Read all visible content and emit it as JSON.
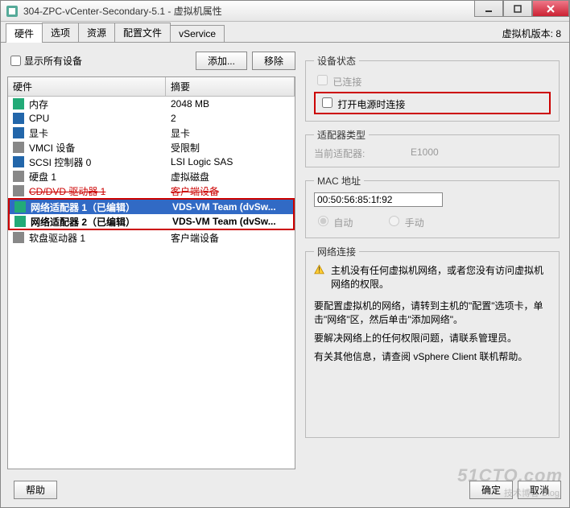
{
  "window": {
    "title": "304-ZPC-vCenter-Secondary-5.1 - 虚拟机属性"
  },
  "tabs": [
    "硬件",
    "选项",
    "资源",
    "配置文件",
    "vService"
  ],
  "version_label": "虚拟机版本: 8",
  "left": {
    "show_all": "显示所有设备",
    "add_btn": "添加...",
    "remove_btn": "移除",
    "col_hw": "硬件",
    "col_sum": "摘要",
    "rows": [
      {
        "name": "内存",
        "sum": "2048 MB",
        "icon": "#2a7"
      },
      {
        "name": "CPU",
        "sum": "2",
        "icon": "#26a"
      },
      {
        "name": "显卡",
        "sum": "显卡",
        "icon": "#26a"
      },
      {
        "name": "VMCI 设备",
        "sum": "受限制",
        "icon": "#888"
      },
      {
        "name": "SCSI 控制器  0",
        "sum": "LSI Logic SAS",
        "icon": "#26a"
      },
      {
        "name": "硬盘  1",
        "sum": "虚拟磁盘",
        "icon": "#888"
      },
      {
        "name": "CD/DVD 驱动器  1",
        "sum": "客户端设备",
        "icon": "#888",
        "strike": true
      },
      {
        "name": "网络适配器 1（已编辑）",
        "sum": "VDS-VM Team (dvSw...",
        "icon": "#2a7",
        "bold": true,
        "selected": true
      },
      {
        "name": "网络适配器 2（已编辑）",
        "sum": "VDS-VM Team (dvSw...",
        "icon": "#2a7",
        "bold": true
      },
      {
        "name": "软盘驱动器  1",
        "sum": "客户端设备",
        "icon": "#888"
      }
    ]
  },
  "right": {
    "devstatus": {
      "legend": "设备状态",
      "connected": "已连接",
      "connect_power": "打开电源时连接"
    },
    "adapter": {
      "legend": "适配器类型",
      "label": "当前适配器:",
      "value": "E1000"
    },
    "mac": {
      "legend": "MAC 地址",
      "value": "00:50:56:85:1f:92",
      "auto": "自动",
      "manual": "手动"
    },
    "netconn": {
      "legend": "网络连接",
      "warn": "主机没有任何虚拟机网络，或者您没有访问虚拟机网络的权限。",
      "p1": "要配置虚拟机的网络，请转到主机的\"配置\"选项卡，单击\"网络\"区，然后单击\"添加网络\"。",
      "p2": "要解决网络上的任何权限问题，请联系管理员。",
      "p3": "有关其他信息，请查阅 vSphere Client 联机帮助。"
    }
  },
  "footer": {
    "help": "帮助",
    "ok": "确定",
    "cancel": "取消"
  },
  "watermark": {
    "main": "51CTO.com",
    "sub": "技术博客  Blog"
  }
}
